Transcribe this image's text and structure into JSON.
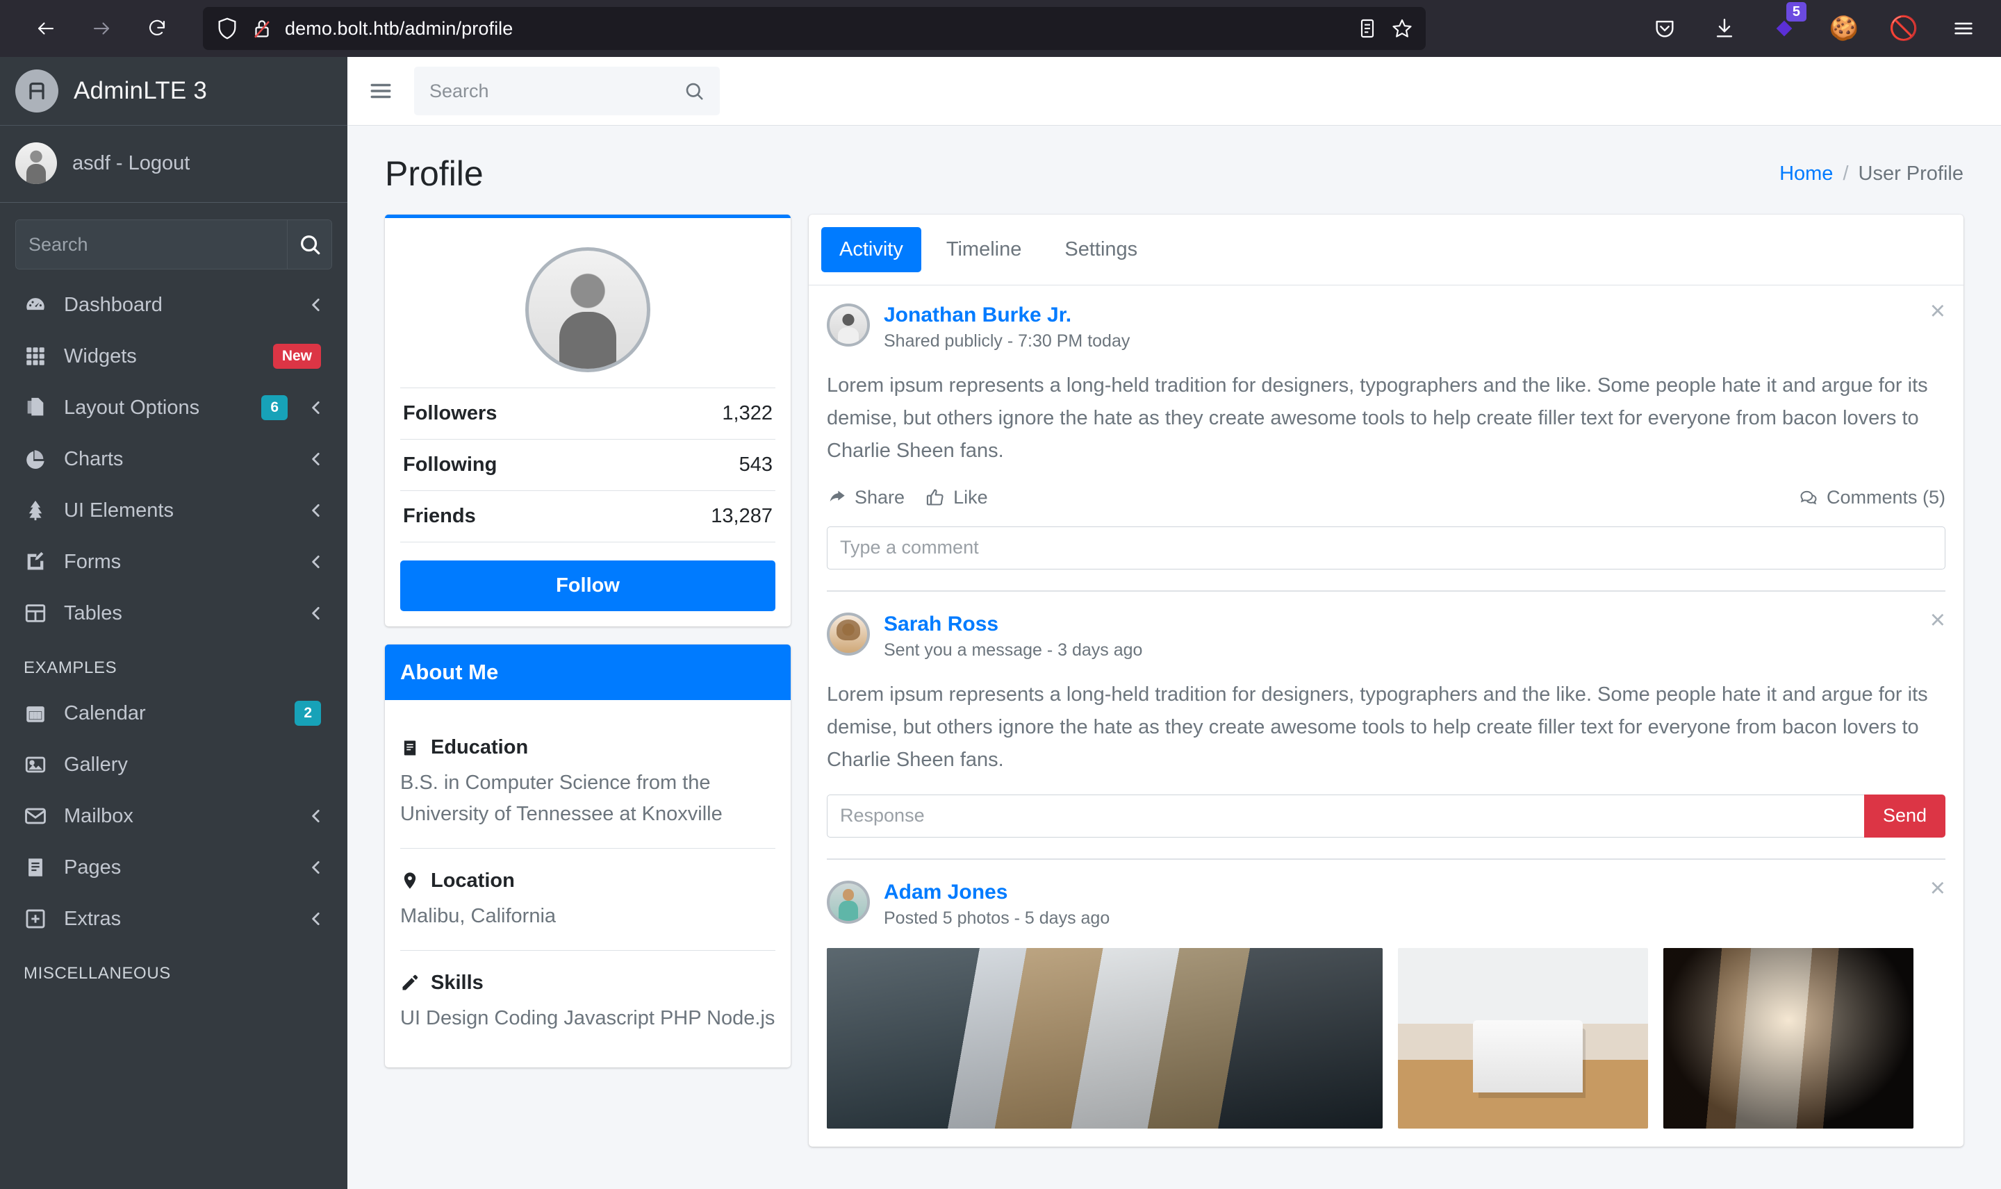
{
  "browser": {
    "url": "demo.bolt.htb/admin/profile",
    "back_label": "Back",
    "forward_label": "Forward",
    "reload_label": "Reload",
    "reader_label": "Reader View",
    "bookmark_label": "Bookmark",
    "pocket_label": "Save to Pocket",
    "downloads_label": "Downloads",
    "extension_badge": "5",
    "cookie_label": "Cookie",
    "nofox_label": "Block",
    "menu_label": "Application Menu"
  },
  "sidebar": {
    "brand": "AdminLTE 3",
    "user": "asdf - Logout",
    "search_placeholder": "Search",
    "search_value": "",
    "items": [
      {
        "label": "Dashboard",
        "icon": "tachometer-icon",
        "chevron": true,
        "badge": null
      },
      {
        "label": "Widgets",
        "icon": "grid-icon",
        "chevron": false,
        "badge": {
          "text": "New",
          "type": "danger"
        }
      },
      {
        "label": "Layout Options",
        "icon": "copy-icon",
        "chevron": true,
        "badge": {
          "text": "6",
          "type": "info"
        }
      },
      {
        "label": "Charts",
        "icon": "pie-chart-icon",
        "chevron": true,
        "badge": null
      },
      {
        "label": "UI Elements",
        "icon": "tree-icon",
        "chevron": true,
        "badge": null
      },
      {
        "label": "Forms",
        "icon": "edit-icon",
        "chevron": true,
        "badge": null
      },
      {
        "label": "Tables",
        "icon": "table-icon",
        "chevron": true,
        "badge": null
      }
    ],
    "examples_header": "EXAMPLES",
    "examples": [
      {
        "label": "Calendar",
        "icon": "calendar-icon",
        "chevron": false,
        "badge": {
          "text": "2",
          "type": "info"
        }
      },
      {
        "label": "Gallery",
        "icon": "image-icon",
        "chevron": false,
        "badge": null
      },
      {
        "label": "Mailbox",
        "icon": "envelope-icon",
        "chevron": true,
        "badge": null
      },
      {
        "label": "Pages",
        "icon": "book-icon",
        "chevron": true,
        "badge": null
      },
      {
        "label": "Extras",
        "icon": "plus-square-icon",
        "chevron": true,
        "badge": null
      }
    ],
    "misc_header": "MISCELLANEOUS"
  },
  "topnav": {
    "search_placeholder": "Search",
    "search_value": ""
  },
  "page": {
    "title": "Profile",
    "breadcrumb_home": "Home",
    "breadcrumb_sep": "/",
    "breadcrumb_current": "User Profile"
  },
  "profile_card": {
    "stats": [
      {
        "label": "Followers",
        "value": "1,322"
      },
      {
        "label": "Following",
        "value": "543"
      },
      {
        "label": "Friends",
        "value": "13,287"
      }
    ],
    "follow_button": "Follow"
  },
  "about_card": {
    "header": "About Me",
    "sections": [
      {
        "icon": "book-icon",
        "title": "Education",
        "text": "B.S. in Computer Science from the University of Tennessee at Knoxville"
      },
      {
        "icon": "map-marker-icon",
        "title": "Location",
        "text": "Malibu, California"
      },
      {
        "icon": "pencil-icon",
        "title": "Skills",
        "text": "UI Design Coding Javascript PHP Node.js"
      }
    ]
  },
  "tabs": [
    {
      "label": "Activity",
      "active": true
    },
    {
      "label": "Timeline",
      "active": false
    },
    {
      "label": "Settings",
      "active": false
    }
  ],
  "posts": [
    {
      "author": "Jonathan Burke Jr.",
      "meta": "Shared publicly - 7:30 PM today",
      "text": "Lorem ipsum represents a long-held tradition for designers, typographers and the like. Some people hate it and argue for its demise, but others ignore the hate as they create awesome tools to help create filler text for everyone from bacon lovers to Charlie Sheen fans.",
      "avatar_class": "av-man2",
      "actions": {
        "share": "Share",
        "like": "Like",
        "comments": "Comments (5)"
      },
      "comment_placeholder": "Type a comment",
      "comment_value": ""
    },
    {
      "author": "Sarah Ross",
      "meta": "Sent you a message - 3 days ago",
      "text": "Lorem ipsum represents a long-held tradition for designers, typographers and the like. Some people hate it and argue for its demise, but others ignore the hate as they create awesome tools to help create filler text for everyone from bacon lovers to Charlie Sheen fans.",
      "avatar_class": "av-woman",
      "response_placeholder": "Response",
      "response_value": "",
      "send_label": "Send"
    },
    {
      "author": "Adam Jones",
      "meta": "Posted 5 photos - 5 days ago",
      "avatar_class": "av-adam",
      "photos": [
        {
          "name": "photo-street",
          "class": "ph-street",
          "size": "wide"
        },
        {
          "name": "photo-dining-room",
          "class": "ph-room",
          "size": "small"
        },
        {
          "name": "photo-alley",
          "class": "ph-alley",
          "size": "small"
        }
      ]
    }
  ],
  "colors": {
    "primary": "#007bff",
    "danger": "#dc3545",
    "info": "#17a2b8",
    "sidebar_bg": "#343a40",
    "content_bg": "#f4f6f9",
    "browser_bg": "#2b2a33"
  }
}
